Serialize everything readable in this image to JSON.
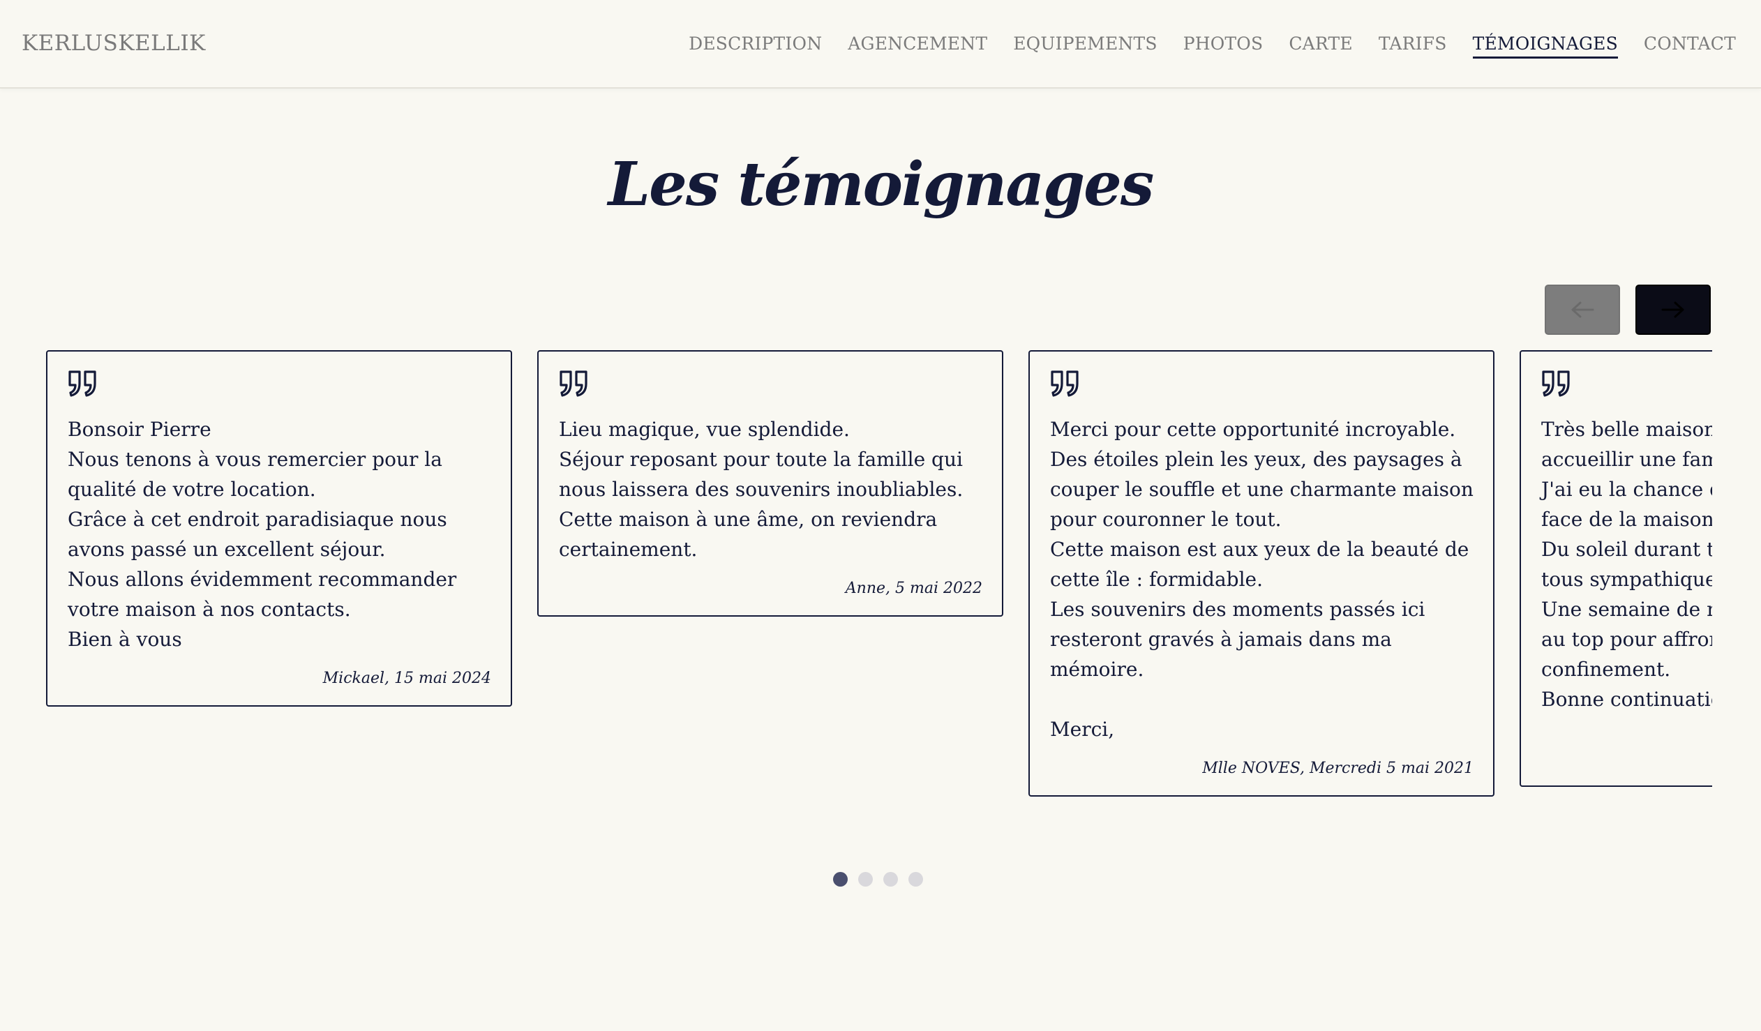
{
  "header": {
    "brand": "KERLUSKELLIK",
    "nav": [
      {
        "label": "DESCRIPTION",
        "active": false
      },
      {
        "label": "AGENCEMENT",
        "active": false
      },
      {
        "label": "EQUIPEMENTS",
        "active": false
      },
      {
        "label": "PHOTOS",
        "active": false
      },
      {
        "label": "CARTE",
        "active": false
      },
      {
        "label": "TARIFS",
        "active": false
      },
      {
        "label": "TÉMOIGNAGES",
        "active": true
      },
      {
        "label": "CONTACT",
        "active": false
      }
    ]
  },
  "section": {
    "title": "Les témoignages"
  },
  "carousel": {
    "prev_icon": "arrow-left-icon",
    "next_icon": "arrow-right-icon",
    "prev_disabled": true,
    "testimonials": [
      {
        "text": "Bonsoir Pierre\nNous tenons à vous remercier pour la qualité de votre location.\nGrâce à cet endroit paradisiaque nous avons passé un excellent séjour.\nNous allons évidemment recommander votre maison à nos contacts.\nBien à vous",
        "author": "Mickael, 15 mai 2024"
      },
      {
        "text": "Lieu magique, vue splendide.\nSéjour reposant pour toute la famille qui nous laissera des souvenirs inoubliables.\nCette maison à une âme, on reviendra certainement.",
        "author": "Anne, 5 mai 2022"
      },
      {
        "text": "Merci pour cette opportunité incroyable.\nDes étoiles plein les yeux, des paysages à couper le souffle et une charmante maison pour couronner le tout.\nCette maison est aux yeux de la beauté de cette île : formidable.\nLes souvenirs des moments passés ici resteront gravés à jamais dans ma mémoire.\n\nMerci,",
        "author": "Mlle NOVES, Mercredi 5 mai 2021"
      },
      {
        "text": "Très belle maison\naccueillir une fam\nJ'ai eu la chance d\nface de la maison\nDu soleil durant t\ntous sympathique\nUne semaine de r\nau top pour affror\nconfinement.\nBonne continuatic",
        "author": ""
      }
    ],
    "dots": [
      true,
      false,
      false,
      false
    ]
  },
  "colors": {
    "background": "#f9f8f2",
    "ink": "#141a38",
    "nav_inactive": "#7b7b7b",
    "prev_button": "#7d7d7d",
    "next_button": "#0b0c17",
    "dot_active": "#4a4f6e",
    "dot_inactive": "#d9d8dc"
  }
}
